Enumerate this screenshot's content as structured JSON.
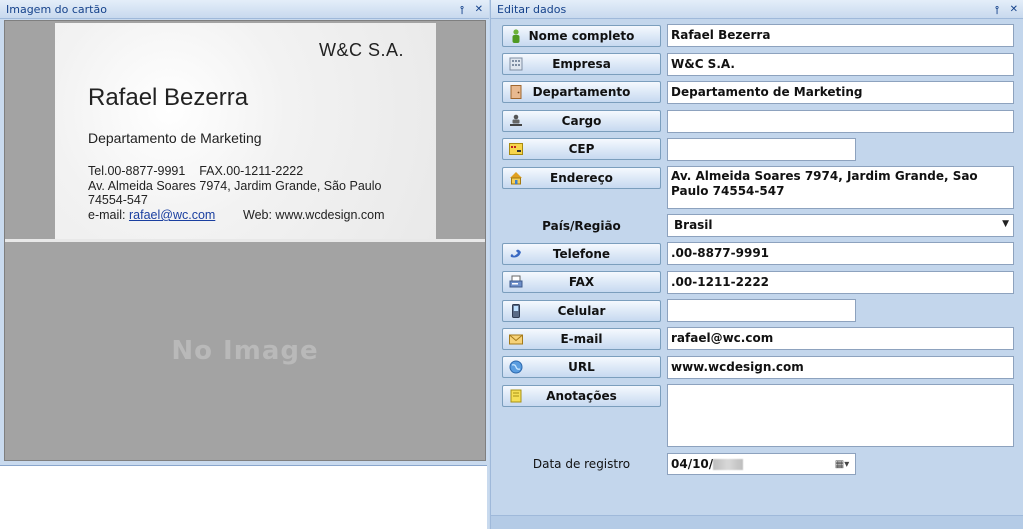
{
  "left_panel": {
    "title": "Imagem do cartão",
    "pin_glyph": "⊸",
    "close_glyph": "✕",
    "card": {
      "company": "W&C S.A.",
      "name": "Rafael Bezerra",
      "department": "Departamento de Marketing",
      "tel_fax": "Tel.00-8877-9991    FAX.00-1211-2222",
      "address": "Av. Almeida Soares 7974, Jardim Grande, São Paulo",
      "postal": "74554-547",
      "email_prefix": "e-mail: ",
      "email": "rafael@wc.com",
      "web": "Web: www.wcdesign.com"
    },
    "no_image_text": "No Image"
  },
  "right_panel": {
    "title": "Editar dados",
    "pin_glyph": "⊸",
    "close_glyph": "✕",
    "fields": {
      "full_name": {
        "label": "Nome completo",
        "value": "Rafael Bezerra",
        "icon": "person-icon"
      },
      "company": {
        "label": "Empresa",
        "value": "W&C S.A.",
        "icon": "building-icon"
      },
      "department": {
        "label": "Departamento",
        "value": "Departamento de Marketing",
        "icon": "door-icon"
      },
      "position": {
        "label": "Cargo",
        "value": "",
        "icon": "desk-icon"
      },
      "postal_code": {
        "label": "CEP",
        "value": "",
        "icon": "postcode-icon"
      },
      "address": {
        "label": "Endereço",
        "value": "Av. Almeida Soares 7974, Jardim Grande, Sao Paulo 74554-547",
        "icon": "house-icon"
      },
      "country": {
        "label": "País/Região",
        "value": "Brasil"
      },
      "phone": {
        "label": "Telefone",
        "value": ".00-8877-9991",
        "icon": "phone-icon"
      },
      "fax": {
        "label": "FAX",
        "value": ".00-1211-2222",
        "icon": "fax-icon"
      },
      "mobile": {
        "label": "Celular",
        "value": "",
        "icon": "mobile-icon"
      },
      "email": {
        "label": "E-mail",
        "value": "rafael@wc.com",
        "icon": "envelope-icon"
      },
      "url": {
        "label": "URL",
        "value": "www.wcdesign.com",
        "icon": "globe-icon"
      },
      "notes": {
        "label": "Anotações",
        "value": "",
        "icon": "note-icon"
      },
      "registration_date": {
        "label": "Data de registro",
        "value": "04/10/"
      }
    }
  }
}
